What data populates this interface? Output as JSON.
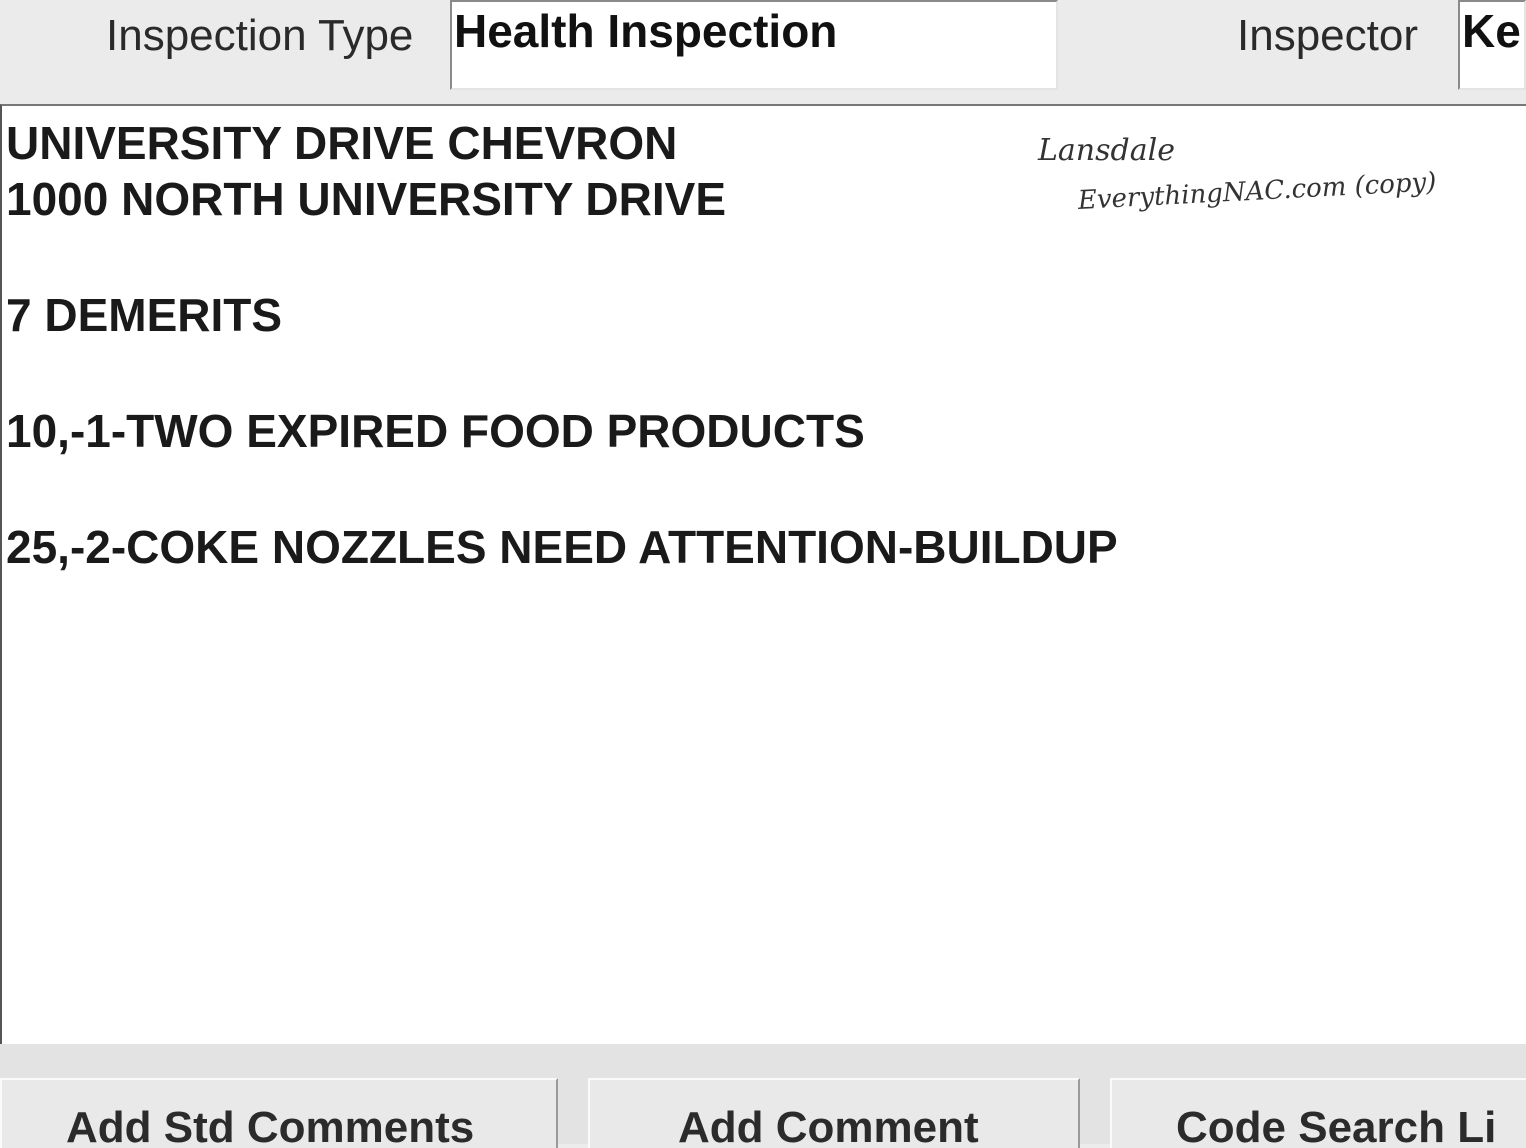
{
  "header": {
    "inspection_type_label": "Inspection Type",
    "inspection_type_value": "Health Inspection",
    "inspector_label": "Inspector",
    "inspector_value": "Ke"
  },
  "comments": {
    "lines": [
      "UNIVERSITY DRIVE CHEVRON",
      "1000 NORTH UNIVERSITY DRIVE",
      "7 DEMERITS",
      "10,-1-TWO EXPIRED FOOD PRODUCTS",
      "25,-2-COKE NOZZLES NEED ATTENTION-BUILDUP"
    ]
  },
  "handwritten_note": {
    "line1": "Lansdale",
    "line2": "EverythingNAC.com (copy)"
  },
  "buttons": {
    "add_std_comments": "Add Std Comments",
    "add_comment": "Add Comment",
    "code_search": "Code Search Li"
  }
}
